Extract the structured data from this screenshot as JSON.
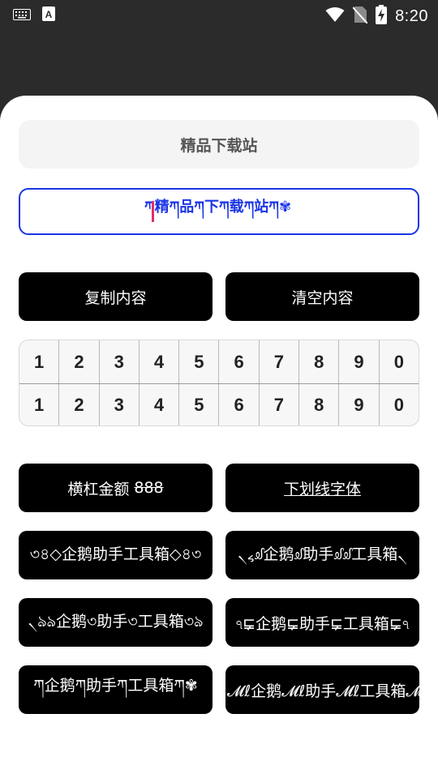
{
  "status_bar": {
    "time": "8:20",
    "icons": [
      "keyboard-icon",
      "text-a-icon",
      "wifi-icon",
      "no-sim-icon",
      "battery-charging-icon"
    ]
  },
  "header": {
    "title": "精品下载站"
  },
  "input": {
    "value": "ཀ︎精ཀ︎品ཀ︎下ཀ︎载ཀ︎站ཀ︎✾"
  },
  "actions": {
    "copy_label": "复制内容",
    "clear_label": "清空内容"
  },
  "number_rows": [
    [
      "1",
      "2",
      "3",
      "4",
      "5",
      "6",
      "7",
      "8",
      "9",
      "0"
    ],
    [
      "1",
      "2",
      "3",
      "4",
      "5",
      "6",
      "7",
      "8",
      "9",
      "0"
    ]
  ],
  "styles": {
    "strike_label": "横杠金额",
    "strike_number": "888",
    "underline_label": "下划线字体",
    "style1": "৩৪◇企鹅助手工具箱◇৪৩",
    "style2": "৲៹ᦾ企鹅ᦾ助手ᦾᦾ工具箱৲",
    "style3": "৲ঌঌ企鹅৩助手৩工具箱৩ঌ",
    "style4": "ঀ⋤企鹅⋤助手⋤工具箱⋤ঀ",
    "style5": "ཀ︎企鹅ཀ︎助手ཀ︎工具箱ཀ︎✾",
    "style6": "𝓜ℓ企鹅𝓜ℓ助手𝓜ℓ工具箱𝓜ℓ"
  },
  "colors": {
    "accent_blue": "#1a35e6",
    "button_bg": "#000000",
    "caret": "#e0306b"
  }
}
